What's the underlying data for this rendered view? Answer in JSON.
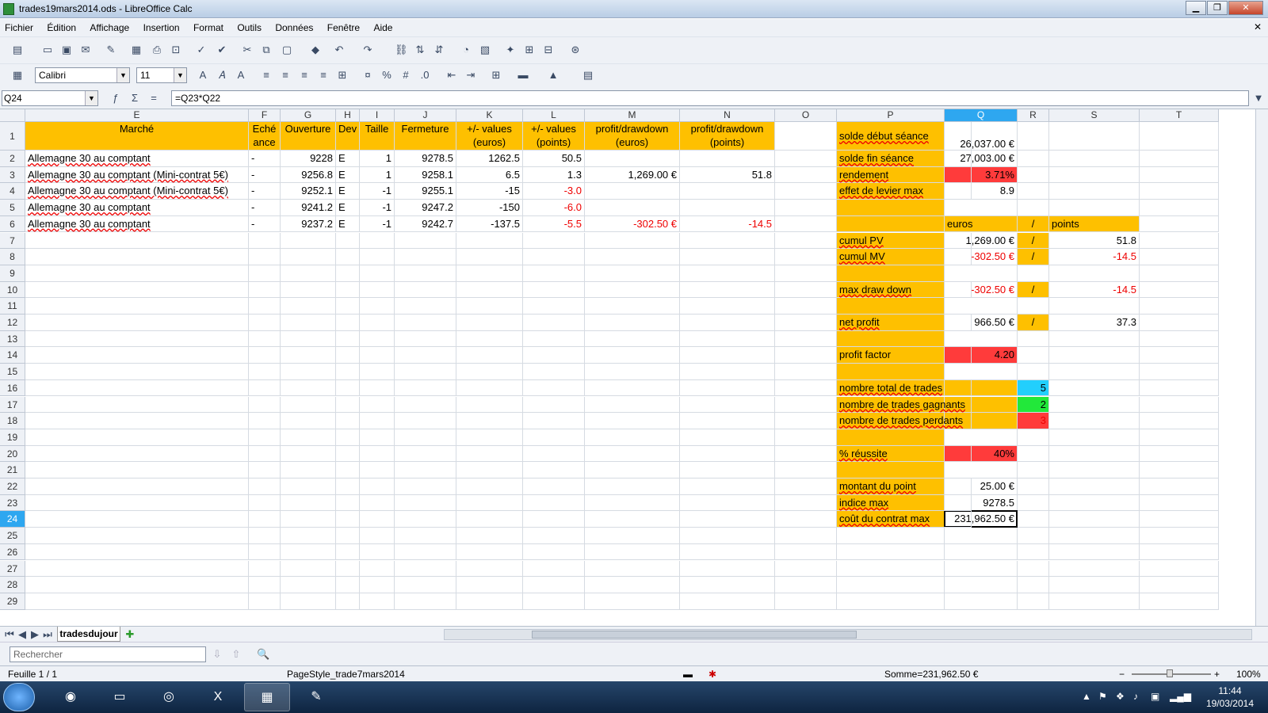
{
  "window": {
    "title": "trades19mars2014.ods - LibreOffice Calc"
  },
  "menu": [
    "Fichier",
    "Édition",
    "Affichage",
    "Insertion",
    "Format",
    "Outils",
    "Données",
    "Fenêtre",
    "Aide"
  ],
  "format_bar": {
    "font_name": "Calibri",
    "font_size": "11"
  },
  "formula_bar": {
    "cell_ref": "Q24",
    "formula": "=Q23*Q22"
  },
  "sheet": {
    "columns": [
      "E",
      "F",
      "G",
      "H",
      "I",
      "J",
      "K",
      "L",
      "M",
      "N",
      "O",
      "P",
      "Q",
      "R",
      "S",
      "T"
    ],
    "row_numbers": [
      "1",
      "2",
      "3",
      "4",
      "5",
      "6",
      "7",
      "8",
      "9",
      "10",
      "11",
      "12",
      "13",
      "14",
      "15",
      "16",
      "17",
      "18",
      "19",
      "20",
      "21",
      "22",
      "23",
      "24",
      "25",
      "26",
      "27",
      "28",
      "29"
    ],
    "selected_column": "Q",
    "selected_row": "24",
    "headers": {
      "E": "Marché",
      "F": [
        "Eché",
        "ance"
      ],
      "G": "Ouverture",
      "H": "Dev",
      "I": "Taille",
      "J": "Fermeture",
      "K": [
        "+/- values",
        "(euros)"
      ],
      "L": [
        "+/- values",
        "(points)"
      ],
      "M": [
        "profit/drawdown",
        "(euros)"
      ],
      "N": [
        "profit/drawdown",
        "(points)"
      ]
    },
    "trades": [
      {
        "marche": "Allemagne 30 au comptant",
        "echeance": "-",
        "ouverture": "9228",
        "dev": "E",
        "taille": "1",
        "fermeture": "9278.5",
        "pv_euros": "1262.5",
        "pv_points": "50.5",
        "pd_euros": "",
        "pd_points": ""
      },
      {
        "marche": "Allemagne 30 au comptant (Mini-contrat 5€)",
        "echeance": "-",
        "ouverture": "9256.8",
        "dev": "E",
        "taille": "1",
        "fermeture": "9258.1",
        "pv_euros": "6.5",
        "pv_points": "1.3",
        "pd_euros": "1,269.00 €",
        "pd_points": "51.8"
      },
      {
        "marche": "Allemagne 30 au comptant (Mini-contrat 5€)",
        "echeance": "-",
        "ouverture": "9252.1",
        "dev": "E",
        "taille": "-1",
        "fermeture": "9255.1",
        "pv_euros": "-15",
        "pv_points": "-3.0",
        "pd_euros": "",
        "pd_points": ""
      },
      {
        "marche": "Allemagne 30 au comptant",
        "echeance": "-",
        "ouverture": "9241.2",
        "dev": "E",
        "taille": "-1",
        "fermeture": "9247.2",
        "pv_euros": "-150",
        "pv_points": "-6.0",
        "pd_euros": "",
        "pd_points": ""
      },
      {
        "marche": "Allemagne 30 au comptant",
        "echeance": "-",
        "ouverture": "9237.2",
        "dev": "E",
        "taille": "-1",
        "fermeture": "9242.7",
        "pv_euros": "-137.5",
        "pv_points": "-5.5",
        "pd_euros": "-302.50 €",
        "pd_points": "-14.5"
      }
    ],
    "stats": {
      "solde_debut": {
        "label": "solde début séance",
        "value": "26,037.00 €"
      },
      "solde_fin": {
        "label": "solde fin séance",
        "value": "27,003.00 €"
      },
      "rendement": {
        "label": "rendement",
        "value": "3.71%"
      },
      "levier": {
        "label": "effet de levier max",
        "value": "8.9"
      },
      "hdr_euros": "euros",
      "slash": "/",
      "hdr_points": "points",
      "cumul_pv": {
        "label": "cumul PV",
        "euros": "1,269.00 €",
        "points": "51.8"
      },
      "cumul_mv": {
        "label": "cumul MV",
        "euros": "-302.50 €",
        "points": "-14.5"
      },
      "max_dd": {
        "label": "max draw down",
        "euros": "-302.50 €",
        "points": "-14.5"
      },
      "net_profit": {
        "label": "net profit",
        "euros": "966.50 €",
        "points": "37.3"
      },
      "profit_factor": {
        "label": "profit factor",
        "value": "4.20"
      },
      "nb_total": {
        "label": "nombre total de trades",
        "value": "5"
      },
      "nb_gagnants": {
        "label": "nombre de trades gagnants",
        "value": "2"
      },
      "nb_perdants": {
        "label": "nombre de trades perdants",
        "value": "3"
      },
      "reussite": {
        "label": "% réussite",
        "value": "40%"
      },
      "montant_point": {
        "label": "montant du point",
        "value": "25.00 €"
      },
      "indice_max": {
        "label": "indice max",
        "value": "9278.5"
      },
      "cout_contrat": {
        "label": "coût du contrat max",
        "value": "231,962.50 €"
      }
    }
  },
  "tabs": {
    "active": "tradesdujour"
  },
  "find": {
    "placeholder": "Rechercher"
  },
  "status": {
    "sheet": "Feuille 1 / 1",
    "page_style": "PageStyle_trade7mars2014",
    "sum": "Somme=231,962.50 €",
    "zoom": "100%"
  },
  "clock": {
    "time": "11:44",
    "date": "19/03/2014"
  },
  "colors": {
    "orange": "#fec000",
    "red": "#ff3b3b",
    "cyan": "#22cffd",
    "green": "#22e83a",
    "selection": "#2ea7f0"
  }
}
